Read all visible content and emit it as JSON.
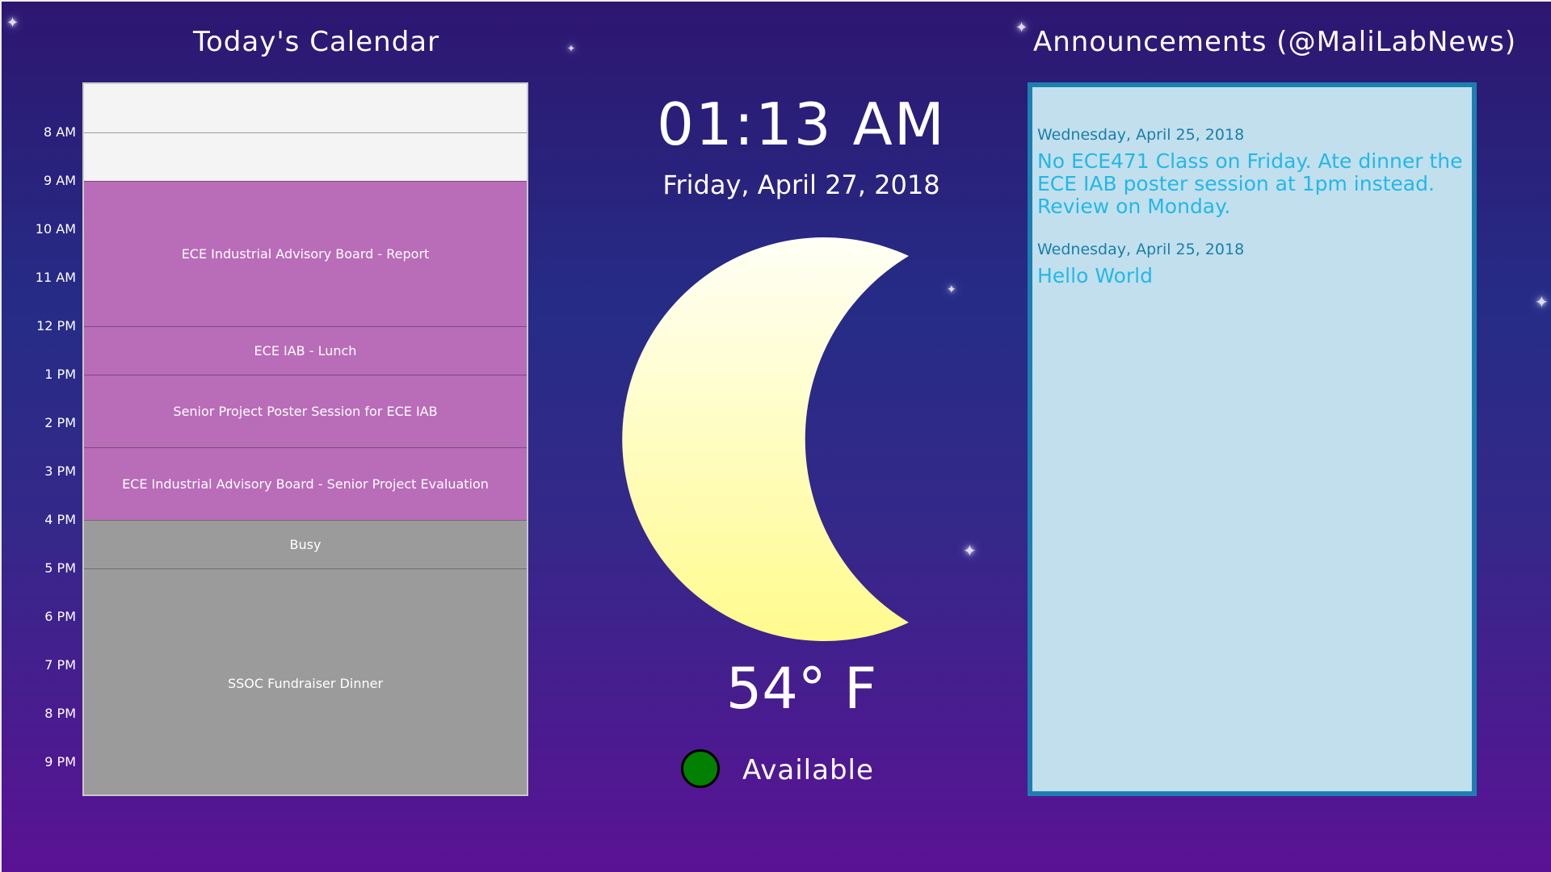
{
  "calendar": {
    "title": "Today's Calendar",
    "time_labels": [
      "8 AM",
      "9 AM",
      "10 AM",
      "11 AM",
      "12 PM",
      "1 PM",
      "2 PM",
      "3 PM",
      "4 PM",
      "5 PM",
      "6 PM",
      "7 PM",
      "8 PM",
      "9 PM"
    ],
    "events": [
      {
        "title": "ECE Industrial Advisory Board - Report",
        "color": "purple"
      },
      {
        "title": "ECE IAB - Lunch",
        "color": "purple"
      },
      {
        "title": "Senior Project Poster Session for ECE IAB",
        "color": "purple"
      },
      {
        "title": "ECE Industrial Advisory Board - Senior Project Evaluation",
        "color": "purple"
      },
      {
        "title": "Busy",
        "color": "gray"
      },
      {
        "title": "SSOC Fundraiser Dinner",
        "color": "gray"
      }
    ]
  },
  "clock": {
    "time": "01:13 AM",
    "date": "Friday, April 27, 2018"
  },
  "weather": {
    "icon": "crescent-moon-icon",
    "temperature": "54° F"
  },
  "status": {
    "label": "Available",
    "color": "#018001"
  },
  "announcements": {
    "title": "Announcements (@MaliLabNews)",
    "items": [
      {
        "date": "Wednesday, April 25, 2018",
        "text": "No ECE471 Class on Friday. Ate dinner the ECE IAB poster session at 1pm instead. Review on Monday."
      },
      {
        "date": "Wednesday, April 25, 2018",
        "text": "Hello World"
      }
    ]
  },
  "colors": {
    "event_purple": "#b96cb8",
    "event_gray": "#9b9b9b",
    "announcement_border": "#1d7fb1",
    "announcement_bg": "#c2dfee"
  }
}
